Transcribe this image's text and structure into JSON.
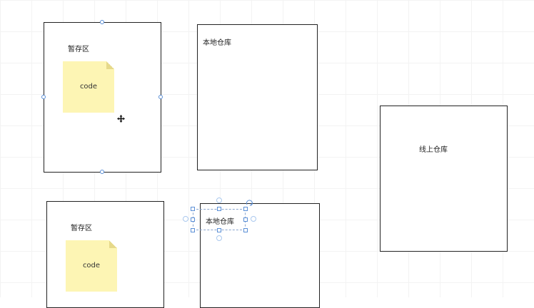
{
  "canvas": {
    "staging_area_1": {
      "label": "暂存区",
      "note": {
        "text": "code"
      }
    },
    "local_repo_1": {
      "label": "本地仓库"
    },
    "online_repo": {
      "label": "线上仓库"
    },
    "staging_area_2": {
      "label": "暂存区",
      "note": {
        "text": "code"
      }
    },
    "local_repo_2": {
      "label": "本地仓库"
    }
  },
  "icons": {
    "move_cursor": "move-cursor-icon",
    "rotate_handle": "rotate-icon"
  },
  "colors": {
    "note_fill": "#fdf5b4",
    "selection": "#5b8fd6",
    "border": "#222222"
  }
}
